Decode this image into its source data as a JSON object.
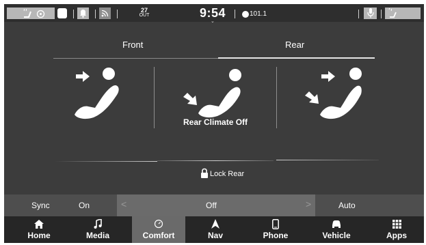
{
  "status_bar": {
    "clock": "9:54",
    "outside_temp_value": "27",
    "outside_temp_label": "OUT",
    "radio_frequency": "101.1",
    "icons": [
      "heated-seat-icon",
      "heated-wheel-icon",
      "notification-bell-icon",
      "rss-icon",
      "microphone-icon",
      "heated-steering-wheel-icon"
    ]
  },
  "tabs": [
    {
      "label": "Front",
      "active": false
    },
    {
      "label": "Rear",
      "active": true
    }
  ],
  "seats": {
    "center_label": "Rear Climate Off"
  },
  "lock": {
    "label": "Lock Rear"
  },
  "fan_row": {
    "sync_label": "Sync",
    "on_label": "On",
    "fan_value": "Off",
    "auto_label": "Auto"
  },
  "nav": [
    {
      "label": "Home",
      "icon": "home-icon",
      "active": false
    },
    {
      "label": "Media",
      "icon": "music-note-icon",
      "active": false
    },
    {
      "label": "Comfort",
      "icon": "climate-icon",
      "active": true
    },
    {
      "label": "Nav",
      "icon": "navigation-arrow-icon",
      "active": false
    },
    {
      "label": "Phone",
      "icon": "phone-icon",
      "active": false
    },
    {
      "label": "Vehicle",
      "icon": "car-icon",
      "active": false
    },
    {
      "label": "Apps",
      "icon": "apps-grid-icon",
      "active": false
    }
  ],
  "colors": {
    "background": "#3c3c3c",
    "status_bar": "#2e2e2e",
    "nav_bar": "#262626",
    "active_nav": "#6a6a6a",
    "fan_row": "#4e4e4e",
    "chip": "#b7b7b7"
  }
}
